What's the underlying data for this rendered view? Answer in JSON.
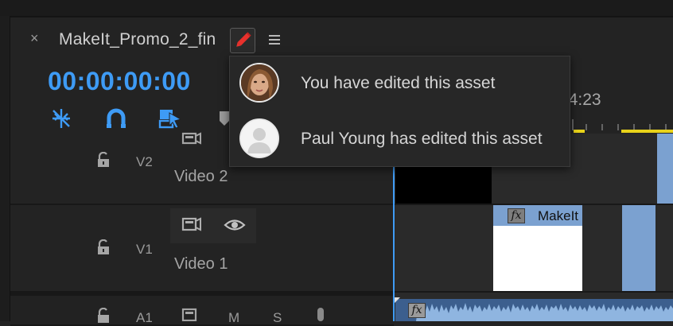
{
  "panel": {
    "close_glyph": "×",
    "sequence_title": "MakeIt_Promo_2_fin",
    "edit_icon": "pencil-icon",
    "menu_icon": "hamburger-menu-icon"
  },
  "timecode": "00:00:00:00",
  "toolbar": {
    "tools": [
      {
        "name": "snap-insert-icon"
      },
      {
        "name": "magnet-icon"
      },
      {
        "name": "linked-selection-icon"
      }
    ]
  },
  "ruler": {
    "time_label": "04:23"
  },
  "edit_popup": {
    "items": [
      {
        "text": "You have edited this asset",
        "avatar": "user-photo-avatar"
      },
      {
        "text": "Paul Young has edited this asset",
        "avatar": "generic-person-avatar"
      }
    ]
  },
  "tracks": [
    {
      "code": "V2",
      "name": "Video 2"
    },
    {
      "code": "V1",
      "name": "Video 1"
    },
    {
      "code": "A1",
      "name": "",
      "mute_label": "M",
      "solo_label": "S"
    }
  ],
  "clips": {
    "v1_label": "MakeIt",
    "fx_label": "fx"
  },
  "colors": {
    "accent": "#3e9bf5",
    "clip": "#7ba1d0",
    "work_area": "#e8d21a",
    "edited_pencil": "#e8312c"
  }
}
